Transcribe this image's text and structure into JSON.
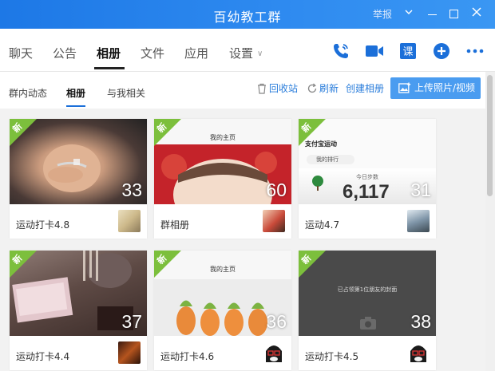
{
  "window": {
    "title": "百幼教工群",
    "report": "举报"
  },
  "tabs": [
    {
      "label": "聊天"
    },
    {
      "label": "公告"
    },
    {
      "label": "相册"
    },
    {
      "label": "文件"
    },
    {
      "label": "应用"
    },
    {
      "label": "设置"
    }
  ],
  "toolbar_icons": [
    "phone-icon",
    "video-call-icon",
    "class-icon",
    "add-icon",
    "more-icon"
  ],
  "class_icon_text": "课",
  "subtabs": [
    {
      "label": "群内动态"
    },
    {
      "label": "相册"
    },
    {
      "label": "与我相关"
    }
  ],
  "actions": {
    "recycle": "回收站",
    "refresh": "刷新",
    "create": "创建相册",
    "upload": "上传照片/视频"
  },
  "badge_new": "新",
  "albums": [
    {
      "name": "运动打卡4.8",
      "count": "33",
      "is_new": true
    },
    {
      "name": "群相册",
      "count": "60",
      "is_new": true,
      "screen_title": "我的主页"
    },
    {
      "name": "运动4.7",
      "count": "31",
      "is_new": true,
      "screen_title": "支付宝运动",
      "rank_label": "我的排行",
      "steps_label": "今日步数",
      "steps": "6,117"
    },
    {
      "name": "运动打卡4.4",
      "count": "37",
      "is_new": true
    },
    {
      "name": "运动打卡4.6",
      "count": "36",
      "is_new": true,
      "screen_title": "我的主页"
    },
    {
      "name": "运动打卡4.5",
      "count": "38",
      "is_new": true,
      "screen_sub": "已占领第1位朋友的封面"
    }
  ],
  "colors": {
    "titlebar": "#1d78e6",
    "accent": "#2a7ddb",
    "new_badge": "#7cbf3c"
  }
}
